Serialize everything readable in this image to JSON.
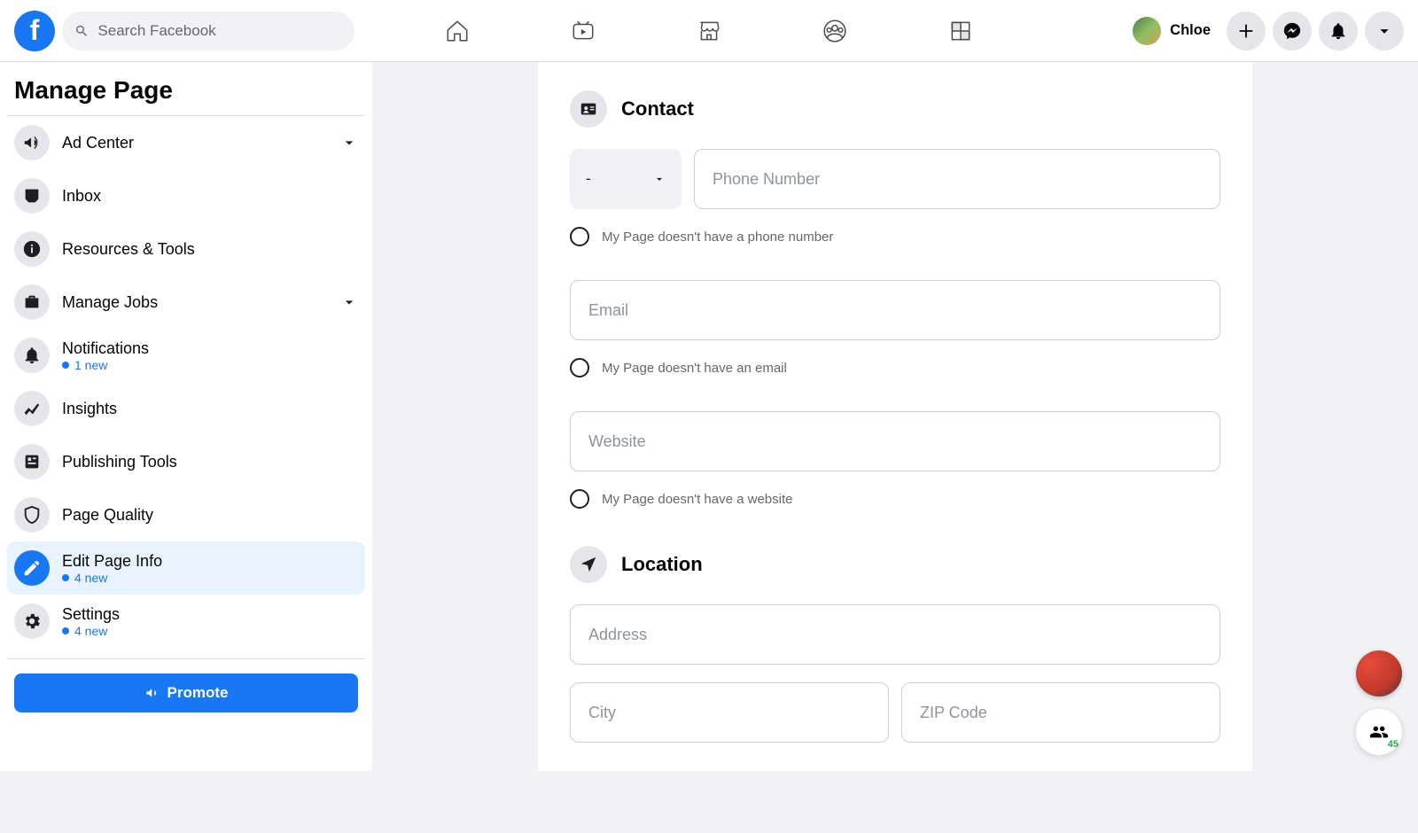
{
  "header": {
    "search_placeholder": "Search Facebook",
    "profile_name": "Chloe"
  },
  "sidebar": {
    "title": "Manage Page",
    "items": [
      {
        "label": "Ad Center",
        "sub": null,
        "chevron": true
      },
      {
        "label": "Inbox",
        "sub": null,
        "chevron": false
      },
      {
        "label": "Resources & Tools",
        "sub": null,
        "chevron": false
      },
      {
        "label": "Manage Jobs",
        "sub": null,
        "chevron": true
      },
      {
        "label": "Notifications",
        "sub": "1 new",
        "chevron": false
      },
      {
        "label": "Insights",
        "sub": null,
        "chevron": false
      },
      {
        "label": "Publishing Tools",
        "sub": null,
        "chevron": false
      },
      {
        "label": "Page Quality",
        "sub": null,
        "chevron": false
      },
      {
        "label": "Edit Page Info",
        "sub": "4 new",
        "chevron": false
      },
      {
        "label": "Settings",
        "sub": "4 new",
        "chevron": false
      }
    ],
    "promote_label": "Promote"
  },
  "form": {
    "contact_title": "Contact",
    "dial_value": "-",
    "phone_placeholder": "Phone Number",
    "no_phone_label": "My Page doesn't have a phone number",
    "email_placeholder": "Email",
    "no_email_label": "My Page doesn't have an email",
    "website_placeholder": "Website",
    "no_website_label": "My Page doesn't have a website",
    "location_title": "Location",
    "address_placeholder": "Address",
    "city_placeholder": "City",
    "zip_placeholder": "ZIP Code"
  },
  "widgets": {
    "contacts_count": "45"
  }
}
